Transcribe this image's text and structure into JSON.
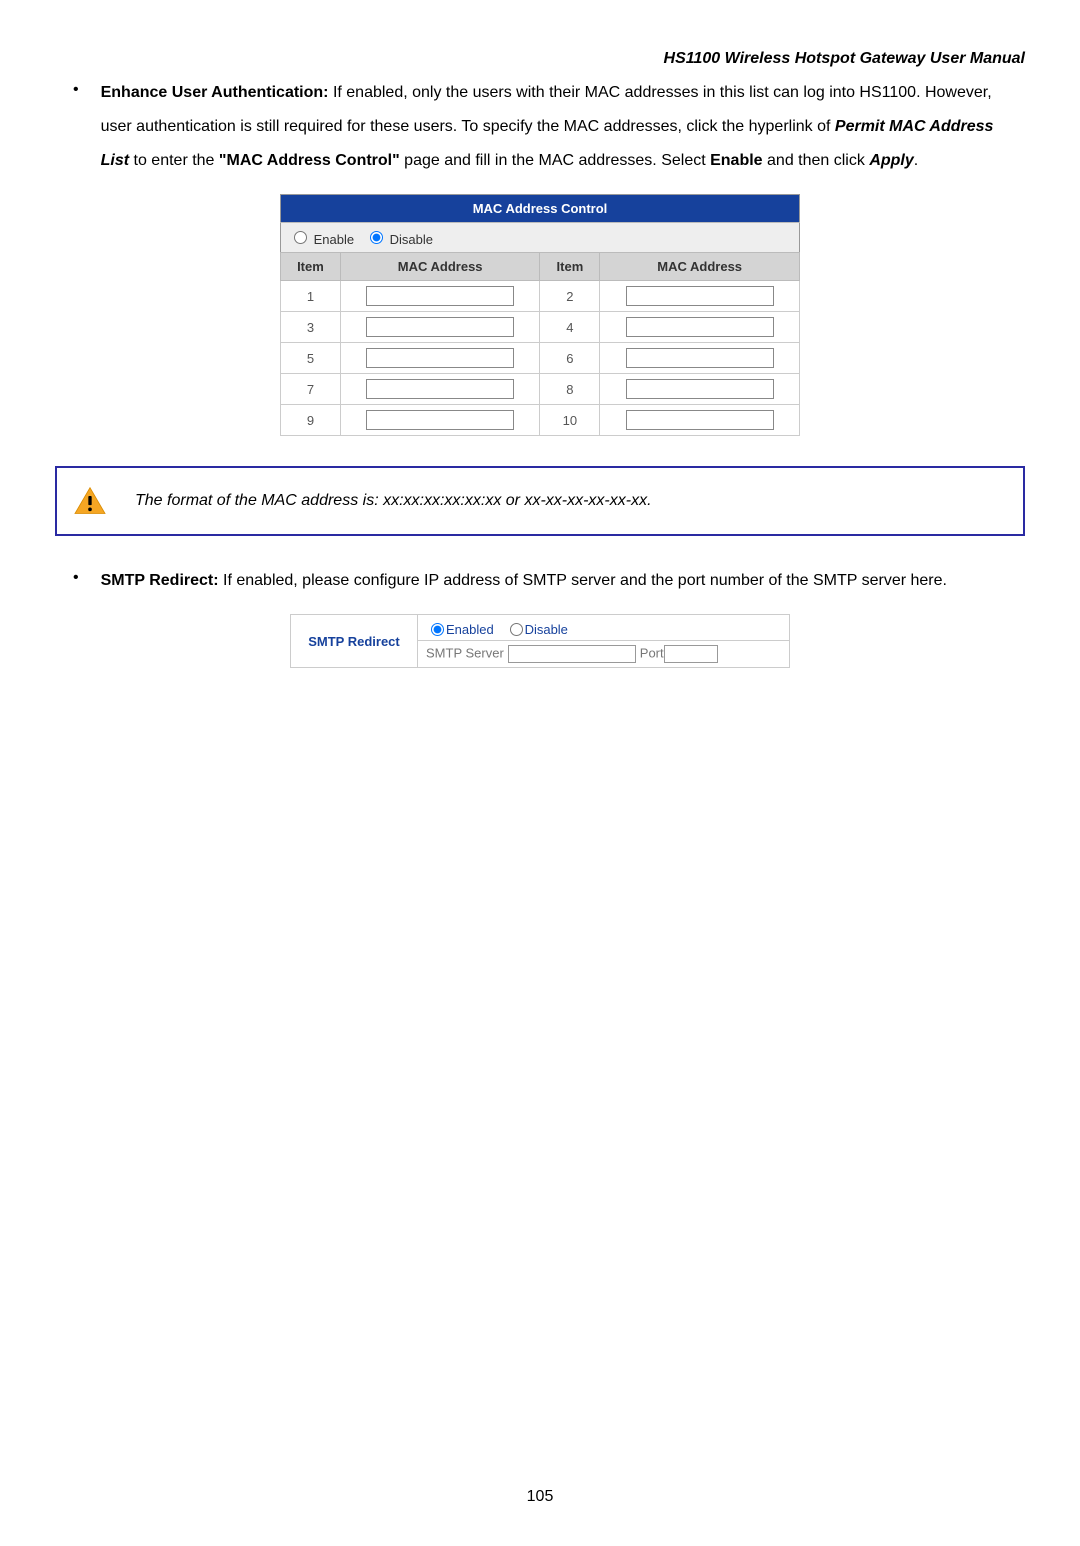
{
  "doc": {
    "title": "HS1100 Wireless Hotspot Gateway User Manual",
    "page_number": "105"
  },
  "section1": {
    "label_bold": "Enhance User Authentication:",
    "text1": " If enabled, only the users with their MAC addresses in this list can log into HS1100. However, user authentication is still required for these users. To specify the MAC addresses, click the hyperlink of ",
    "link_text": "Permit MAC Address List",
    "text2": " to enter the ",
    "quote_text": "\"MAC Address Control\"",
    "text3": " page and fill in the MAC addresses. Select ",
    "enable_word": "Enable",
    "text4": " and then click ",
    "apply_word": "Apply",
    "period": "."
  },
  "mac_table": {
    "title": "MAC Address Control",
    "enable_label": "Enable",
    "disable_label": "Disable",
    "col_item": "Item",
    "col_mac": "MAC Address",
    "rows": [
      {
        "a": "1",
        "b": "2"
      },
      {
        "a": "3",
        "b": "4"
      },
      {
        "a": "5",
        "b": "6"
      },
      {
        "a": "7",
        "b": "8"
      },
      {
        "a": "9",
        "b": "10"
      }
    ]
  },
  "alert": {
    "text": "The format of the MAC address is: xx:xx:xx:xx:xx:xx or xx-xx-xx-xx-xx-xx."
  },
  "section2": {
    "label_bold": "SMTP Redirect:",
    "text": " If enabled, please configure IP address of SMTP server and the port number of the SMTP server here."
  },
  "smtp": {
    "section_label": "SMTP Redirect",
    "enabled_label": "Enabled",
    "disable_label": "Disable",
    "server_label": "SMTP Server",
    "port_label": "Port"
  }
}
